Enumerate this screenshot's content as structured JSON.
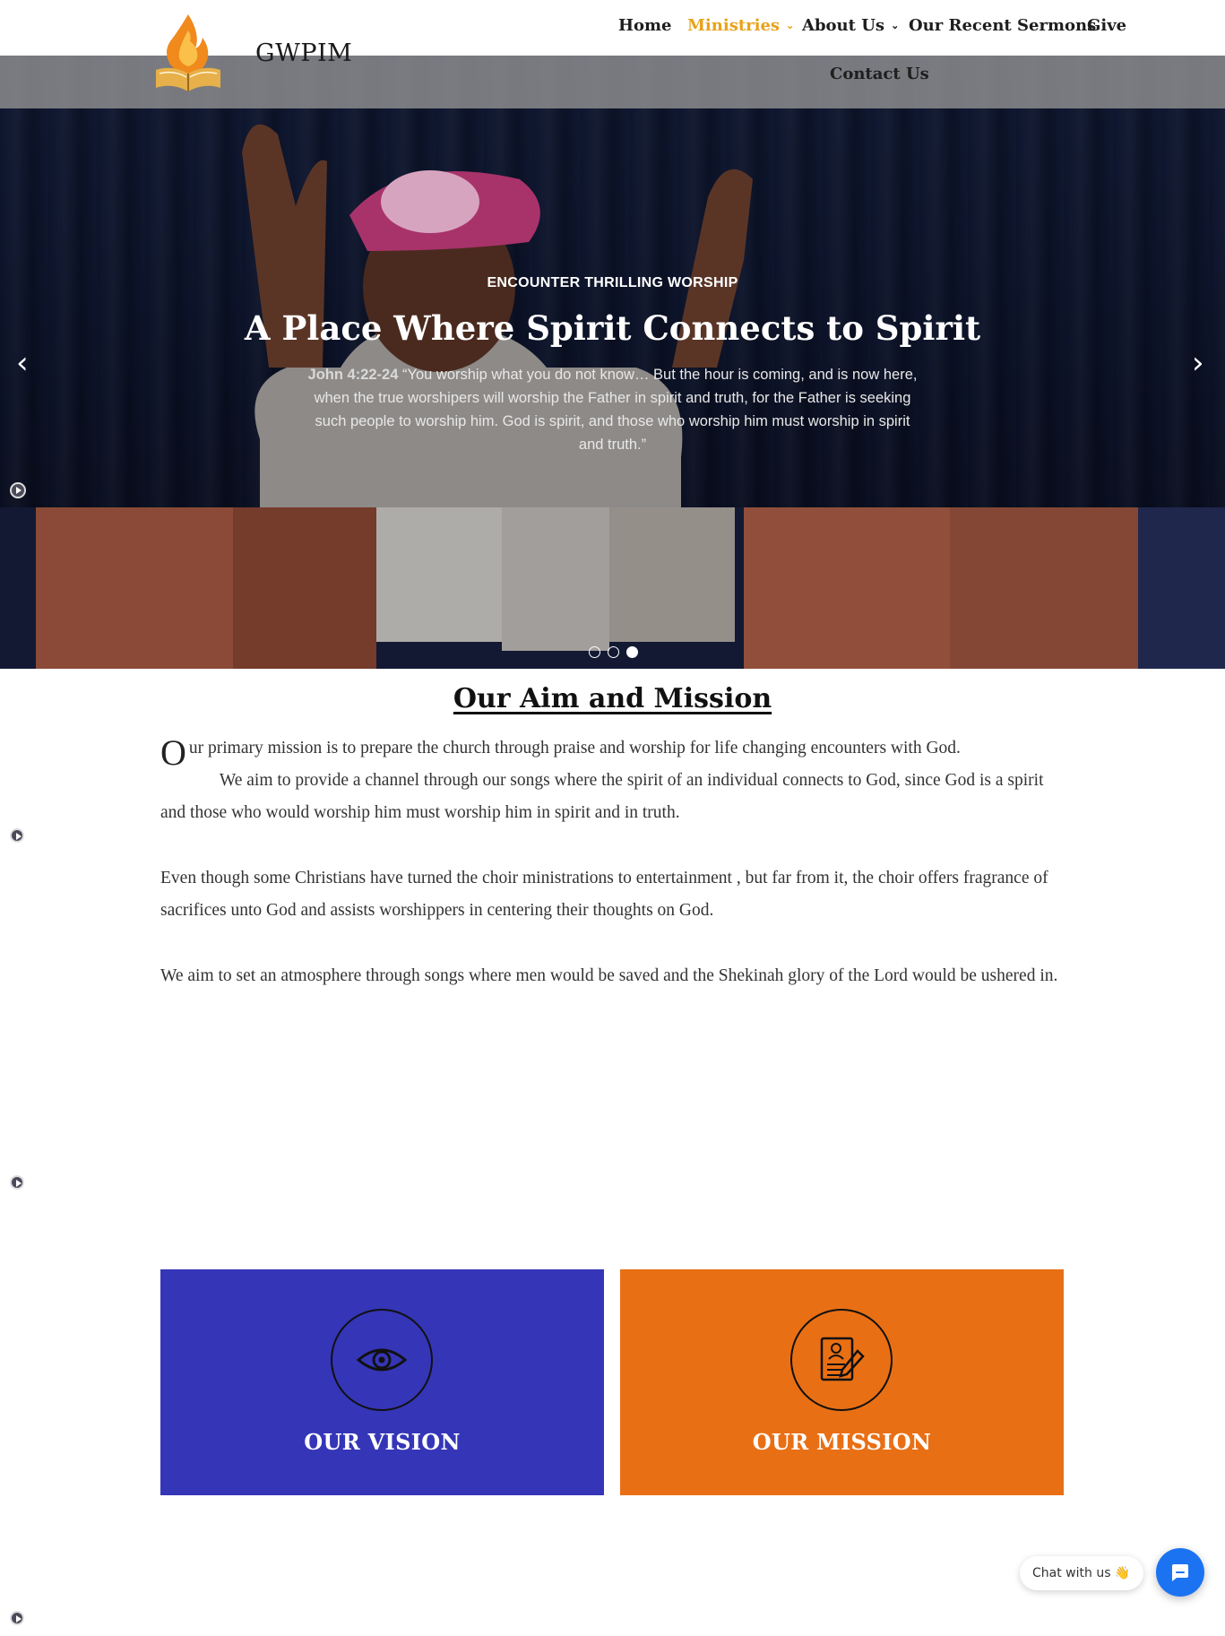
{
  "header": {
    "brand": "GWPIM",
    "nav": [
      {
        "label": "Home",
        "active": false,
        "has_dropdown": false
      },
      {
        "label": "Ministries",
        "active": true,
        "has_dropdown": true
      },
      {
        "label": "About Us",
        "active": false,
        "has_dropdown": true
      },
      {
        "label": "Our Recent Sermons",
        "active": false,
        "has_dropdown": false
      },
      {
        "label": "Give",
        "active": false,
        "has_dropdown": false
      },
      {
        "label": "Contact Us",
        "active": false,
        "has_dropdown": false
      }
    ],
    "active_color": "#e9a21a"
  },
  "hero": {
    "subtitle": "ENCOUNTER THRILLING WORSHIP",
    "title": "A Place Where Spirit Connects to Spirit",
    "scripture_ref": "John 4:22-24",
    "scripture_text": "“You worship what you do not know… But the hour is coming, and is now here, when the true worshipers will worship the Father in spirit and truth, for the Father is seeking such people to worship him. God is spirit, and those who worship him must worship in spirit and truth.”",
    "prev_icon": "chevron-left-icon",
    "next_icon": "chevron-right-icon",
    "slides": 3,
    "active_slide": 3
  },
  "mission": {
    "heading": "Our Aim and Mission",
    "p1_dropcap": "O",
    "p1_rest": "ur primary mission is to prepare the church through praise and worship for life changing encounters with God.",
    "p1_second": "We aim to provide a channel through our songs where the spirit of an individual connects to God, since God is a spirit and those who would worship him must worship him in spirit and in truth.",
    "p2": "Even though some Christians have turned the choir ministrations to entertainment , but far from it, the choir offers fragrance of sacrifices unto God and assists worshippers in centering their thoughts on God.",
    "p3": "We aim to set an atmosphere through songs where men would be saved and the Shekinah glory of the Lord would be ushered in."
  },
  "cards": {
    "vision": {
      "label": "OUR VISION",
      "icon": "eye-icon",
      "color": "#3535b8"
    },
    "mission": {
      "label": "OUR MISSION",
      "icon": "document-pen-icon",
      "color": "#e96f14"
    }
  },
  "chat": {
    "label": "Chat with us",
    "wave": "👋",
    "button_color": "#1b73f2"
  }
}
